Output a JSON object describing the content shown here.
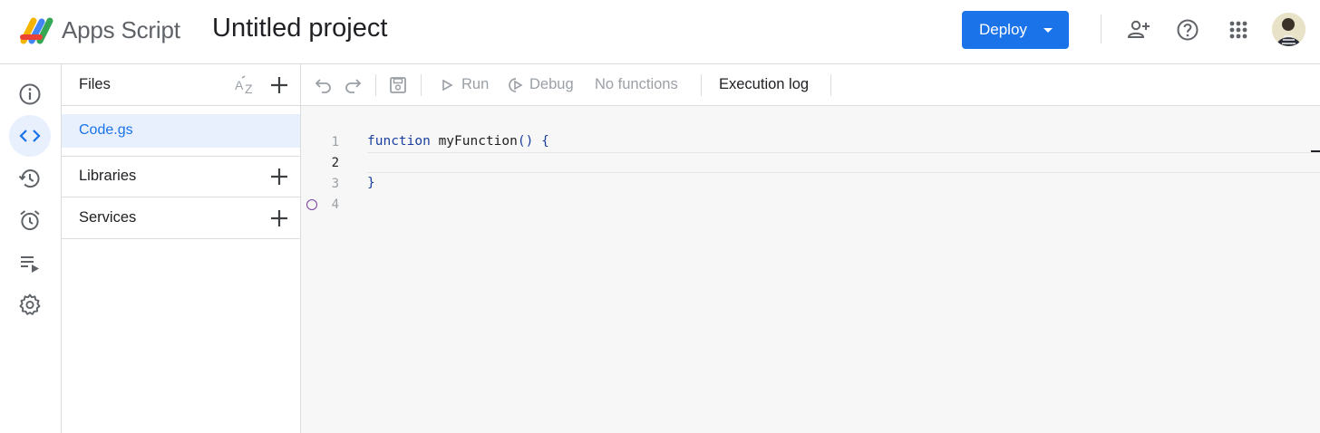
{
  "header": {
    "app_name": "Apps Script",
    "project_title": "Untitled project",
    "deploy_label": "Deploy",
    "icons": [
      "add-person-icon",
      "help-icon",
      "apps-grid-icon"
    ]
  },
  "rail": {
    "items": [
      {
        "name": "overview",
        "icon": "info-icon"
      },
      {
        "name": "editor",
        "icon": "code-icon",
        "active": true
      },
      {
        "name": "project-history",
        "icon": "history-icon"
      },
      {
        "name": "triggers",
        "icon": "alarm-icon"
      },
      {
        "name": "executions",
        "icon": "executions-list-icon"
      },
      {
        "name": "project-settings",
        "icon": "gear-icon"
      }
    ]
  },
  "files_panel": {
    "files_label": "Files",
    "files": [
      "Code.gs"
    ],
    "libraries_label": "Libraries",
    "services_label": "Services"
  },
  "toolbar": {
    "run_label": "Run",
    "debug_label": "Debug",
    "function_select": "No functions",
    "execution_log_label": "Execution log"
  },
  "editor": {
    "line_numbers": [
      "1",
      "2",
      "3",
      "4"
    ],
    "lines": {
      "l1_kw": "function",
      "l1_name": " myFunction",
      "l1_punc": "() {",
      "l3": "}"
    }
  },
  "colors": {
    "accent": "#1a73e8",
    "active_bg": "#e8f0fe",
    "keyword": "#1a3e9e"
  }
}
